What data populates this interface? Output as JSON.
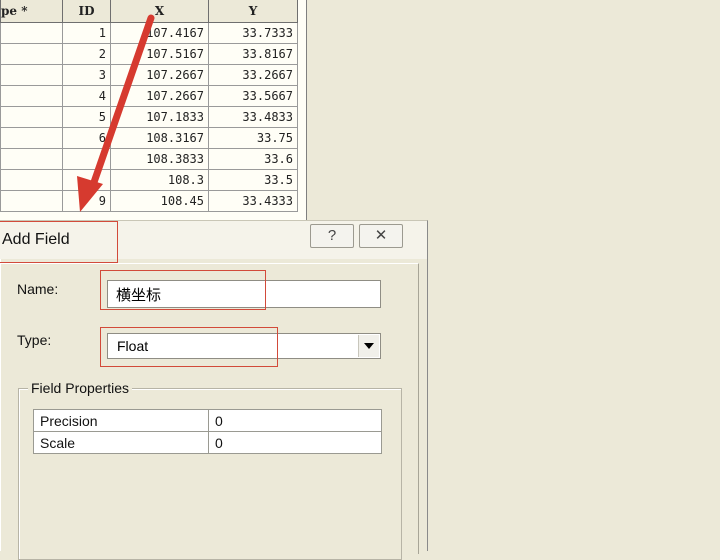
{
  "table": {
    "headers": [
      "pe *",
      "ID",
      "X",
      "Y"
    ],
    "rows": [
      [
        "",
        "1",
        "107.4167",
        "33.7333"
      ],
      [
        "",
        "2",
        "107.5167",
        "33.8167"
      ],
      [
        "",
        "3",
        "107.2667",
        "33.2667"
      ],
      [
        "",
        "4",
        "107.2667",
        "33.5667"
      ],
      [
        "",
        "5",
        "107.1833",
        "33.4833"
      ],
      [
        "",
        "6",
        "108.3167",
        "33.75"
      ],
      [
        "",
        "",
        "108.3833",
        "33.6"
      ],
      [
        "",
        "",
        "108.3",
        "33.5"
      ],
      [
        "",
        "9",
        "108.45",
        "33.4333"
      ]
    ]
  },
  "dialog": {
    "title": "Add Field",
    "help_icon": "question-mark-icon",
    "close_icon": "close-x-icon",
    "help_glyph": "?",
    "close_glyph": "✕",
    "name_label": "Name:",
    "name_value": "横坐标",
    "type_label": "Type:",
    "type_value": "Float",
    "group_title": "Field Properties",
    "properties": [
      {
        "key": "Precision",
        "value": "0"
      },
      {
        "key": "Scale",
        "value": "0"
      }
    ]
  },
  "colors": {
    "annotation_red": "#d63a2f",
    "window_bg": "#ece9d8"
  }
}
